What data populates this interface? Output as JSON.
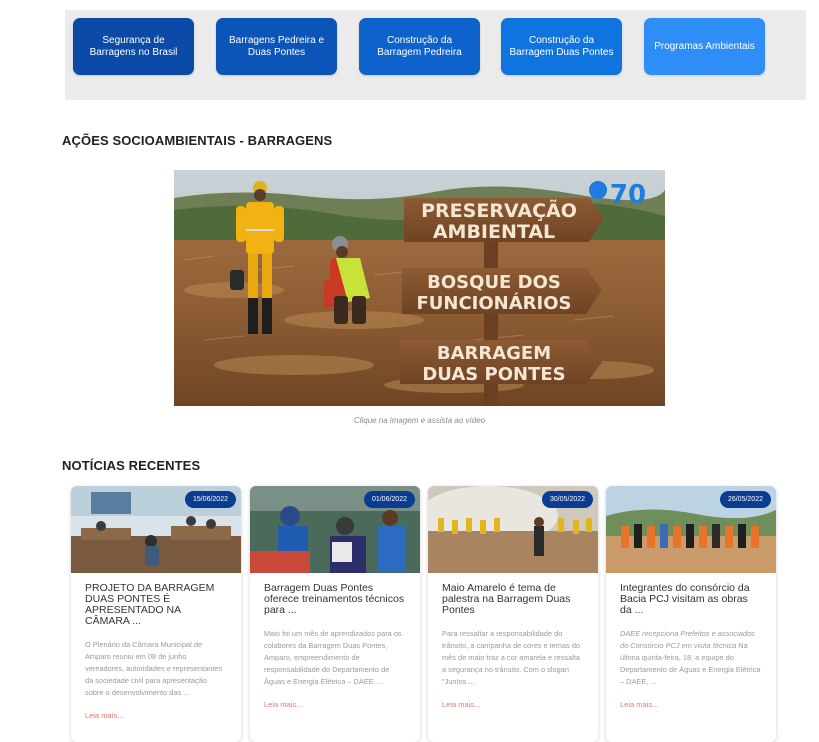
{
  "nav": {
    "buttons": [
      {
        "label": "Segurança de Barragens no Brasil",
        "color": "#0b4aa6"
      },
      {
        "label": "Barragens Pedreira e Duas Pontes",
        "color": "#0c55b8"
      },
      {
        "label": "Construção da Barragem Pedreira",
        "color": "#0d62cc"
      },
      {
        "label": "Construção da Barragem Duas Pontes",
        "color": "#0f74e0"
      },
      {
        "label": "Programas Ambientais",
        "color": "#2f8ef5"
      }
    ]
  },
  "section_actions": {
    "title": "AÇÕES SOCIOAMBIENTAIS - BARRAGENS",
    "caption": "Clique na imagem e assista ao vídeo",
    "signs": [
      "PRESERVAÇÃO",
      "AMBIENTAL",
      "BOSQUE DOS",
      "FUNCIONÁRIOS",
      "BARRAGEM",
      "DUAS PONTES"
    ],
    "logo": "70"
  },
  "section_news": {
    "title": "NOTÍCIAS RECENTES",
    "read_more": "Leia mais...",
    "cards": [
      {
        "date": "15/06/2022",
        "title": "PROJETO DA BARRAGEM DUAS PONTES É APRESENTADO NA CÂMARA ...",
        "excerpt": "O Plenário da Câmara Municipal de Amparo reuniu em 08 de junho vereadores, autoridades e representantes da sociedade civil para apresentação sobre o desenvolvimento das ..."
      },
      {
        "date": "01/06/2022",
        "title": "Barragem Duas Pontes oferece treinamentos técnicos para ...",
        "excerpt": "Maio foi um mês de aprendizados para os colabores da Barragem Duas Pontes, Amparo, empreendimento de responsabilidade do Departamento de Águas e Energia Elétrica – DAEE. ..."
      },
      {
        "date": "30/05/2022",
        "title": "Maio Amarelo é tema de palestra na Barragem Duas Pontes",
        "excerpt": "Para ressaltar a responsabilidade do trânsito, a campanha de cores e temas do mês de maio traz a cor amarela e ressalta a segurança no trânsito. Com o slogan \"Juntos ..."
      },
      {
        "date": "26/05/2022",
        "title": "Integrantes do consórcio da Bacia PCJ visitam as obras da ...",
        "excerpt_italic": "DAEE recepciona Prefeitos e associados do Consórcio PCJ em visita técnica",
        "excerpt": " Na última quinta-feira, 18, a equipe do Departamento de Águas e Energia Elétrica – DAEE, ..."
      }
    ]
  }
}
